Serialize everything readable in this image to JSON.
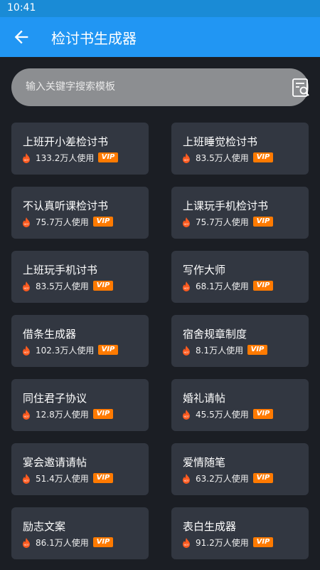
{
  "status_bar": {
    "time": "10:41"
  },
  "app_bar": {
    "title": "检讨书生成器",
    "back_icon": "arrow-left-icon"
  },
  "search": {
    "placeholder": "输入关键字搜索模板",
    "icon": "search-document-icon"
  },
  "colors": {
    "app_bar": "#2196f3",
    "background": "#1b1e24",
    "card": "#323741",
    "vip": "#ff7a00",
    "fire": "#ff5a1f"
  },
  "templates": [
    {
      "title": "上班开小差检讨书",
      "usage": "133.2万人使用",
      "badge": "VIP"
    },
    {
      "title": "上班睡觉检讨书",
      "usage": "83.5万人使用",
      "badge": "VIP"
    },
    {
      "title": "不认真听课检讨书",
      "usage": "75.7万人使用",
      "badge": "VIP"
    },
    {
      "title": "上课玩手机检讨书",
      "usage": "75.7万人使用",
      "badge": "VIP"
    },
    {
      "title": "上班玩手机讨书",
      "usage": "83.5万人使用",
      "badge": "VIP"
    },
    {
      "title": "写作大师",
      "usage": "68.1万人使用",
      "badge": "VIP"
    },
    {
      "title": "借条生成器",
      "usage": "102.3万人使用",
      "badge": "VIP"
    },
    {
      "title": "宿舍规章制度",
      "usage": "8.1万人使用",
      "badge": "VIP"
    },
    {
      "title": "同住君子协议",
      "usage": "12.8万人使用",
      "badge": "VIP"
    },
    {
      "title": "婚礼请帖",
      "usage": "45.5万人使用",
      "badge": "VIP"
    },
    {
      "title": "宴会邀请请帖",
      "usage": "51.4万人使用",
      "badge": "VIP"
    },
    {
      "title": "爱情随笔",
      "usage": "63.2万人使用",
      "badge": "VIP"
    },
    {
      "title": "励志文案",
      "usage": "86.1万人使用",
      "badge": "VIP"
    },
    {
      "title": "表白生成器",
      "usage": "91.2万人使用",
      "badge": "VIP"
    }
  ]
}
